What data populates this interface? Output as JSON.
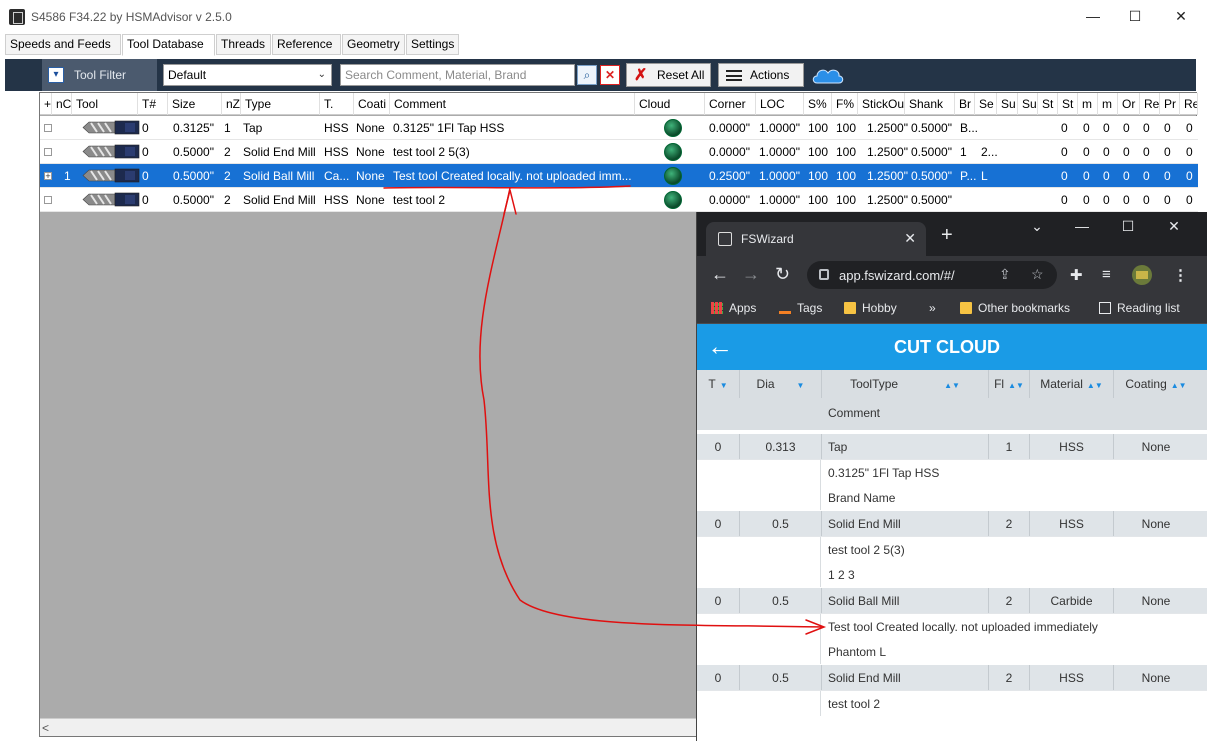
{
  "hsm": {
    "window_title": "S4586 F34.22 by HSMAdvisor v 2.5.0",
    "controls": {
      "minimize": "—",
      "maximize": "☐",
      "close": "✕"
    },
    "tabs": [
      "Speeds and Feeds",
      "Tool Database",
      "Threads",
      "Reference",
      "Geometry",
      "Settings"
    ],
    "active_tab": "Tool Database",
    "toolbar": {
      "tool_filter_label": "Tool Filter",
      "preset_value": "Default",
      "search_placeholder": "Search Comment, Material, Brand",
      "reset_label": "Reset All",
      "actions_label": "Actions"
    },
    "columns": [
      "+",
      "nC",
      "Tool",
      "T#",
      "Size",
      "nZ",
      "Type",
      "T.",
      "Coati",
      "Comment",
      "Cloud",
      "Corner",
      "LOC",
      "S%",
      "F%",
      "StickOu",
      "Shank",
      "Br",
      "Se",
      "Su",
      "Su",
      "St",
      "St",
      "m",
      "m",
      "Or",
      "Re",
      "Pr",
      "Re"
    ],
    "rows": [
      {
        "plus": "",
        "nc": "",
        "tnum": "0",
        "size": "0.3125\"",
        "nz": "1",
        "type": "Tap",
        "tm": "HSS",
        "coat": "None",
        "comment": "0.3125\" 1Fl Tap HSS",
        "corner": "0.0000\"",
        "loc": "1.0000\"",
        "s": "100",
        "f": "100",
        "stick": "1.2500\"",
        "shank": "0.5000\"",
        "br": "B...",
        "se": "",
        "z": [
          "0",
          "0",
          "0",
          "0",
          "0",
          "0",
          "0"
        ]
      },
      {
        "plus": "",
        "nc": "",
        "tnum": "0",
        "size": "0.5000\"",
        "nz": "2",
        "type": "Solid End Mill",
        "tm": "HSS",
        "coat": "None",
        "comment": "test tool 2 5(3)",
        "corner": "0.0000\"",
        "loc": "1.0000\"",
        "s": "100",
        "f": "100",
        "stick": "1.2500\"",
        "shank": "0.5000\"",
        "br": "1",
        "se": "2...",
        "z": [
          "0",
          "0",
          "0",
          "0",
          "0",
          "0",
          "0"
        ]
      },
      {
        "plus": "+",
        "nc": "1",
        "tnum": "0",
        "size": "0.5000\"",
        "nz": "2",
        "type": "Solid Ball Mill",
        "tm": "Ca...",
        "coat": "None",
        "comment": "Test tool Created locally. not uploaded imm...",
        "corner": "0.2500\"",
        "loc": "1.0000\"",
        "s": "100",
        "f": "100",
        "stick": "1.2500\"",
        "shank": "0.5000\"",
        "br": "P...",
        "se": "L",
        "z": [
          "0",
          "0",
          "0",
          "0",
          "0",
          "0",
          "0"
        ]
      },
      {
        "plus": "",
        "nc": "",
        "tnum": "0",
        "size": "0.5000\"",
        "nz": "2",
        "type": "Solid End Mill",
        "tm": "HSS",
        "coat": "None",
        "comment": "test tool 2",
        "corner": "0.0000\"",
        "loc": "1.0000\"",
        "s": "100",
        "f": "100",
        "stick": "1.2500\"",
        "shank": "0.5000\"",
        "br": "",
        "se": "",
        "z": [
          "0",
          "0",
          "0",
          "0",
          "0",
          "0",
          "0"
        ]
      }
    ],
    "selected_row": 2
  },
  "browser": {
    "tab_title": "FSWizard",
    "url": "app.fswizard.com/#/",
    "bookmarks": [
      "Apps",
      "Tags",
      "Hobby",
      "Other bookmarks",
      "Reading list"
    ],
    "bookmarks_more": "»",
    "app_title": "CUT CLOUD",
    "columns": [
      "T",
      "Dia",
      "ToolType",
      "Fl",
      "Material",
      "Coating"
    ],
    "comment_header": "Comment",
    "rows": [
      {
        "t": "0",
        "dia": "0.313",
        "type": "Tap",
        "fl": "1",
        "material": "HSS",
        "coating": "None",
        "lines": [
          "0.3125\" 1Fl Tap HSS",
          "Brand Name"
        ]
      },
      {
        "t": "0",
        "dia": "0.5",
        "type": "Solid End Mill",
        "fl": "2",
        "material": "HSS",
        "coating": "None",
        "lines": [
          "test tool 2 5(3)",
          "1 2 3"
        ]
      },
      {
        "t": "0",
        "dia": "0.5",
        "type": "Solid Ball Mill",
        "fl": "2",
        "material": "Carbide",
        "coating": "None",
        "lines": [
          "Test tool Created locally. not uploaded immediately",
          "Phantom L"
        ]
      },
      {
        "t": "0",
        "dia": "0.5",
        "type": "Solid End Mill",
        "fl": "2",
        "material": "HSS",
        "coating": "None",
        "lines": [
          "test tool 2"
        ]
      }
    ]
  },
  "colors": {
    "toolbar_bg": "#243447",
    "selection": "#1771d4",
    "cut_cloud_header": "#1a9be6",
    "annotation": "#e01010"
  }
}
